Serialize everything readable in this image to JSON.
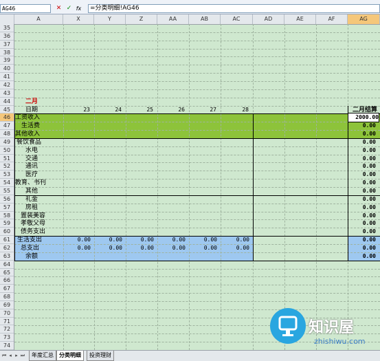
{
  "formula_bar": {
    "name_box": "AG46",
    "cancel_icon": "✕",
    "enter_icon": "✓",
    "function_icon": "fx",
    "formula": "=分类明细!AG46"
  },
  "columns": [
    "A",
    "X",
    "Y",
    "Z",
    "AA",
    "AB",
    "AC",
    "AD",
    "AE",
    "AF",
    "AG"
  ],
  "selected_column": "AG",
  "rows": [
    "35",
    "36",
    "37",
    "38",
    "39",
    "40",
    "41",
    "42",
    "43",
    "44",
    "45",
    "46",
    "47",
    "48",
    "49",
    "50",
    "51",
    "52",
    "53",
    "54",
    "55",
    "56",
    "57",
    "58",
    "59",
    "60",
    "61",
    "62",
    "63",
    "64",
    "65",
    "66",
    "67",
    "68",
    "69",
    "70",
    "71",
    "72",
    "73",
    "74"
  ],
  "selected_row": "46",
  "sheet": {
    "month": "二月",
    "date_label": "日期",
    "days": [
      "23",
      "24",
      "25",
      "26",
      "27",
      "28"
    ],
    "summary_header": "二月结算",
    "categories": [
      "工资收入",
      "生活费",
      "其他收入",
      "餐饮食品",
      "水电",
      "交通",
      "通讯",
      "医疗",
      "教育、书刊",
      "其他",
      "礼金",
      "房租",
      "置装美容",
      "孝敬父母",
      "债务支出",
      "生活支出",
      "总支出",
      "余额"
    ],
    "daily_values": {
      "生活支出": [
        "0.00",
        "0.00",
        "0.00",
        "0.00",
        "0.00",
        "0.00"
      ],
      "总支出": [
        "0.00",
        "0.00",
        "0.00",
        "0.00",
        "0.00",
        "0.00"
      ]
    },
    "summary_values": [
      "2000.00",
      "0.00",
      "0.00",
      "0.00",
      "0.00",
      "0.00",
      "0.00",
      "0.00",
      "0.00",
      "0.00",
      "0.00",
      "0.00",
      "0.00",
      "0.00",
      "0.00",
      "0.00",
      "0.00",
      "0.00"
    ]
  },
  "tabs": [
    "年度汇总",
    "分类明细",
    "投资理财"
  ],
  "active_tab": "分类明细",
  "tab_nav_icons": [
    "⏮",
    "◂",
    "▸",
    "⏭"
  ],
  "watermark": {
    "title": "知识屋",
    "url": "zhishiwu.com"
  },
  "colors": {
    "income_band": "#8dc33a",
    "expense_band": "#9ec8f0",
    "grid_bg": "#cfe8cf",
    "month_red": "#cc0000",
    "selected_header": "#f5c77a"
  }
}
